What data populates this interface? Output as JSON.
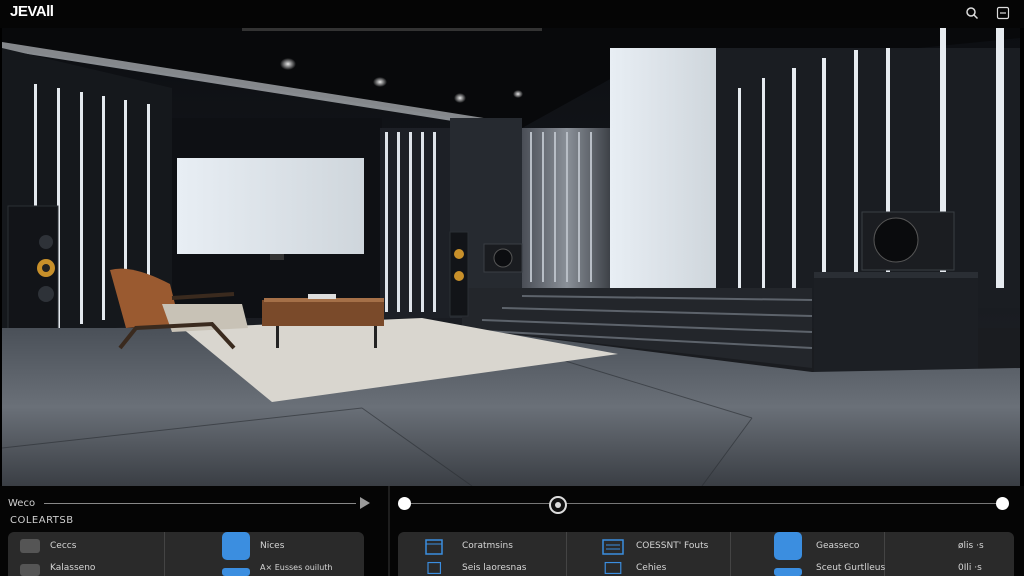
{
  "app": {
    "logo": "JEVAll"
  },
  "toolbar": {
    "search_icon": "search-icon",
    "window_icon": "window-icon"
  },
  "left_panel": {
    "title": "Weco",
    "subtitle": "COLEARTSB",
    "items": [
      {
        "label": "Ceccs",
        "icon": "gray-square-icon"
      },
      {
        "label": "Nices",
        "icon": "blue-app-icon"
      },
      {
        "label": "Kalasseno",
        "icon": "gray-square-icon"
      },
      {
        "label": "A× Eusses ouiluth",
        "icon": "blue-app-icon"
      }
    ]
  },
  "right_panel": {
    "items": [
      {
        "label": "Coratmsins",
        "icon": "folder-icon"
      },
      {
        "label": "COESSNT' Fouts",
        "icon": "panel-icon"
      },
      {
        "label": "Geasseco",
        "icon": "blue-app-icon"
      },
      {
        "label": "ølis",
        "value": "·s"
      },
      {
        "label": "Seis laoresnas",
        "icon": "folder-icon"
      },
      {
        "label": "Cehies",
        "icon": "panel-icon"
      },
      {
        "label": "Sceut Gurtlleus",
        "icon": "blue-app-icon"
      },
      {
        "label": "0Ili",
        "value": "·s"
      }
    ]
  },
  "colors": {
    "accent": "#3b8ee0",
    "panel": "#2a2a2a",
    "background": "#050505"
  }
}
